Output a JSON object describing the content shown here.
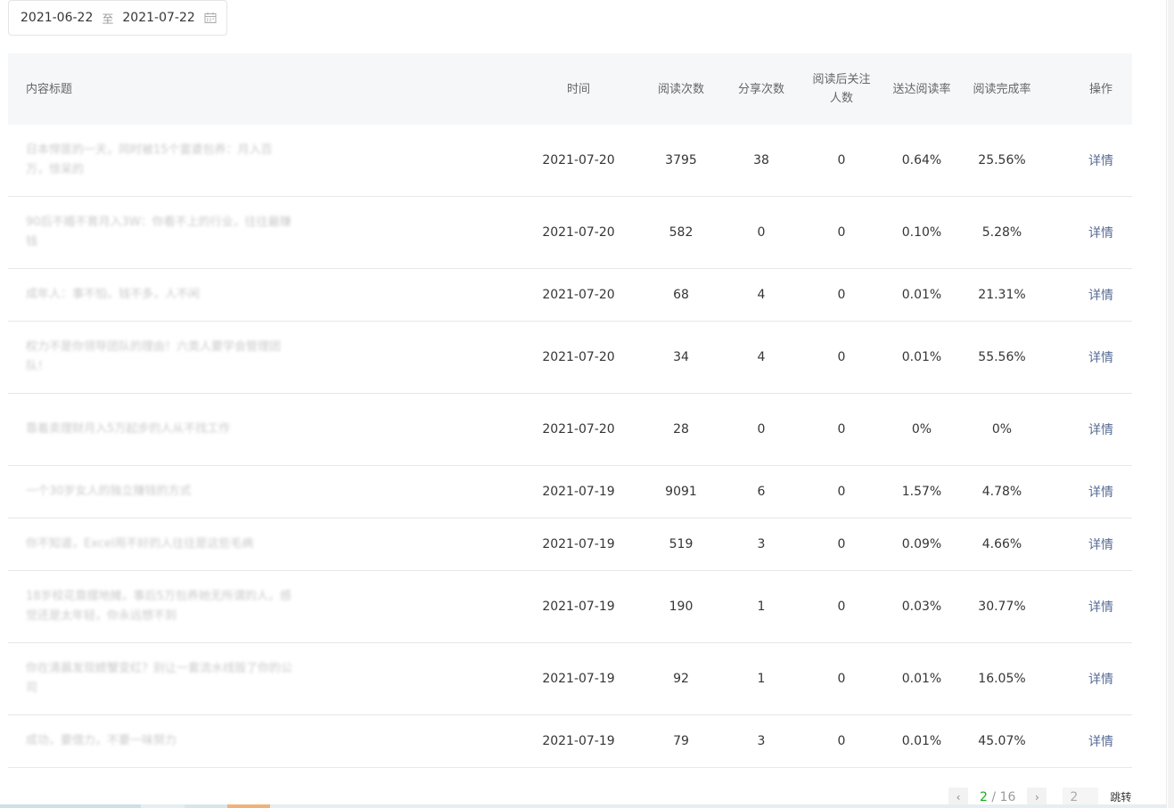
{
  "date_range": {
    "start": "2021-06-22",
    "separator": "至",
    "end": "2021-07-22"
  },
  "table": {
    "headers": {
      "title": "内容标题",
      "time": "时间",
      "reads": "阅读次数",
      "shares": "分享次数",
      "follow_line1": "阅读后关注",
      "follow_line2": "人数",
      "deliver_rate": "送达阅读率",
      "complete_rate": "阅读完成率",
      "action": "操作"
    },
    "rows": [
      {
        "title": "日本悍匪的一天，同时被15个富婆包养：月入百万，惊呆的",
        "time": "2021-07-20",
        "reads": "3795",
        "shares": "38",
        "follow": "0",
        "deliver_rate": "0.64%",
        "complete_rate": "25.56%",
        "action": "详情"
      },
      {
        "title": "90后不婚不育月入3W：你看不上的行业，往往最赚钱",
        "time": "2021-07-20",
        "reads": "582",
        "shares": "0",
        "follow": "0",
        "deliver_rate": "0.10%",
        "complete_rate": "5.28%",
        "action": "详情"
      },
      {
        "title": "成年人：事不怕，钱不多，人不闲",
        "time": "2021-07-20",
        "reads": "68",
        "shares": "4",
        "follow": "0",
        "deliver_rate": "0.01%",
        "complete_rate": "21.31%",
        "action": "详情"
      },
      {
        "title": "权力不是你领导团队的理由！六类人要学会管理团队！",
        "time": "2021-07-20",
        "reads": "34",
        "shares": "4",
        "follow": "0",
        "deliver_rate": "0.01%",
        "complete_rate": "55.56%",
        "action": "详情"
      },
      {
        "title": "靠着卖理财月入5万起步的人从不找工作",
        "time": "2021-07-20",
        "reads": "28",
        "shares": "0",
        "follow": "0",
        "deliver_rate": "0%",
        "complete_rate": "0%",
        "action": "详情"
      },
      {
        "title": "一个30岁女人的独立赚钱的方式",
        "time": "2021-07-19",
        "reads": "9091",
        "shares": "6",
        "follow": "0",
        "deliver_rate": "1.57%",
        "complete_rate": "4.78%",
        "action": "详情"
      },
      {
        "title": "你不知道，Excel用不好的人往往是这些毛病",
        "time": "2021-07-19",
        "reads": "519",
        "shares": "3",
        "follow": "0",
        "deliver_rate": "0.09%",
        "complete_rate": "4.66%",
        "action": "详情"
      },
      {
        "title": "18岁校花靠摆地摊，事后5万包养她无所谓的人，感觉还是太年轻，你永远想不到",
        "time": "2021-07-19",
        "reads": "190",
        "shares": "1",
        "follow": "0",
        "deliver_rate": "0.03%",
        "complete_rate": "30.77%",
        "action": "详情"
      },
      {
        "title": "你在清晨发现螃蟹变红？别让一套流水线毁了你的公司",
        "time": "2021-07-19",
        "reads": "92",
        "shares": "1",
        "follow": "0",
        "deliver_rate": "0.01%",
        "complete_rate": "16.05%",
        "action": "详情"
      },
      {
        "title": "成功，要借力，不要一味努力",
        "time": "2021-07-19",
        "reads": "79",
        "shares": "3",
        "follow": "0",
        "deliver_rate": "0.01%",
        "complete_rate": "45.07%",
        "action": "详情"
      }
    ]
  },
  "pager": {
    "current": "2",
    "separator": " / ",
    "total": "16",
    "input_value": "2",
    "jump_label": "跳转"
  },
  "colors": {
    "accent_green": "#1aad19",
    "link_blue": "#576b95"
  }
}
